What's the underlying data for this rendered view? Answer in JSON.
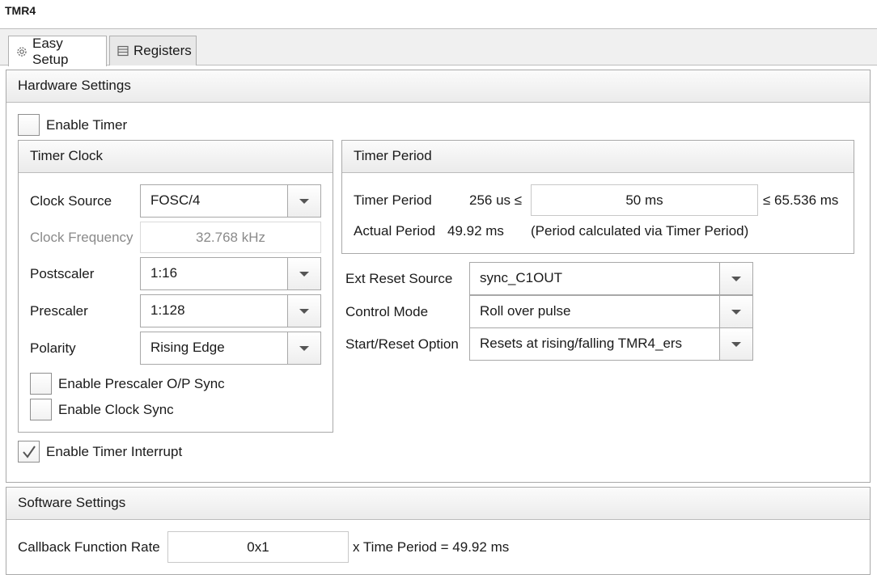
{
  "window": {
    "title": "TMR4"
  },
  "tabs": [
    {
      "label": "Easy Setup",
      "icon": "gear-icon",
      "active": true
    },
    {
      "label": "Registers",
      "icon": "list-icon",
      "active": false
    }
  ],
  "hardware": {
    "header": "Hardware Settings",
    "enable_timer": {
      "label": "Enable Timer",
      "checked": false
    },
    "timer_clock": {
      "header": "Timer Clock",
      "clock_source": {
        "label": "Clock Source",
        "value": "FOSC/4"
      },
      "clock_frequency": {
        "label": "Clock Frequency",
        "value": "32.768 kHz"
      },
      "postscaler": {
        "label": "Postscaler",
        "value": "1:16"
      },
      "prescaler": {
        "label": "Prescaler",
        "value": "1:128"
      },
      "polarity": {
        "label": "Polarity",
        "value": "Rising Edge"
      },
      "prescaler_sync": {
        "label": "Enable Prescaler O/P Sync",
        "checked": false
      },
      "clock_sync": {
        "label": "Enable Clock Sync",
        "checked": false
      }
    },
    "timer_period": {
      "header": "Timer Period",
      "period_label": "Timer Period",
      "min": "256 us ≤",
      "value": "50 ms",
      "max": "≤ 65.536 ms",
      "actual_label": "Actual Period",
      "actual_value": "49.92 ms",
      "note": "(Period calculated via Timer Period)"
    },
    "ext_reset_source": {
      "label": "Ext Reset Source",
      "value": "sync_C1OUT"
    },
    "control_mode": {
      "label": "Control Mode",
      "value": "Roll over pulse"
    },
    "start_reset": {
      "label": "Start/Reset Option",
      "value": "Resets at rising/falling TMR4_ers"
    },
    "interrupt": {
      "label": "Enable Timer Interrupt",
      "checked": true
    }
  },
  "software": {
    "header": "Software Settings",
    "callback_label": "Callback Function Rate",
    "callback_value": "0x1",
    "callback_suffix": "x Time Period = 49.92 ms"
  }
}
